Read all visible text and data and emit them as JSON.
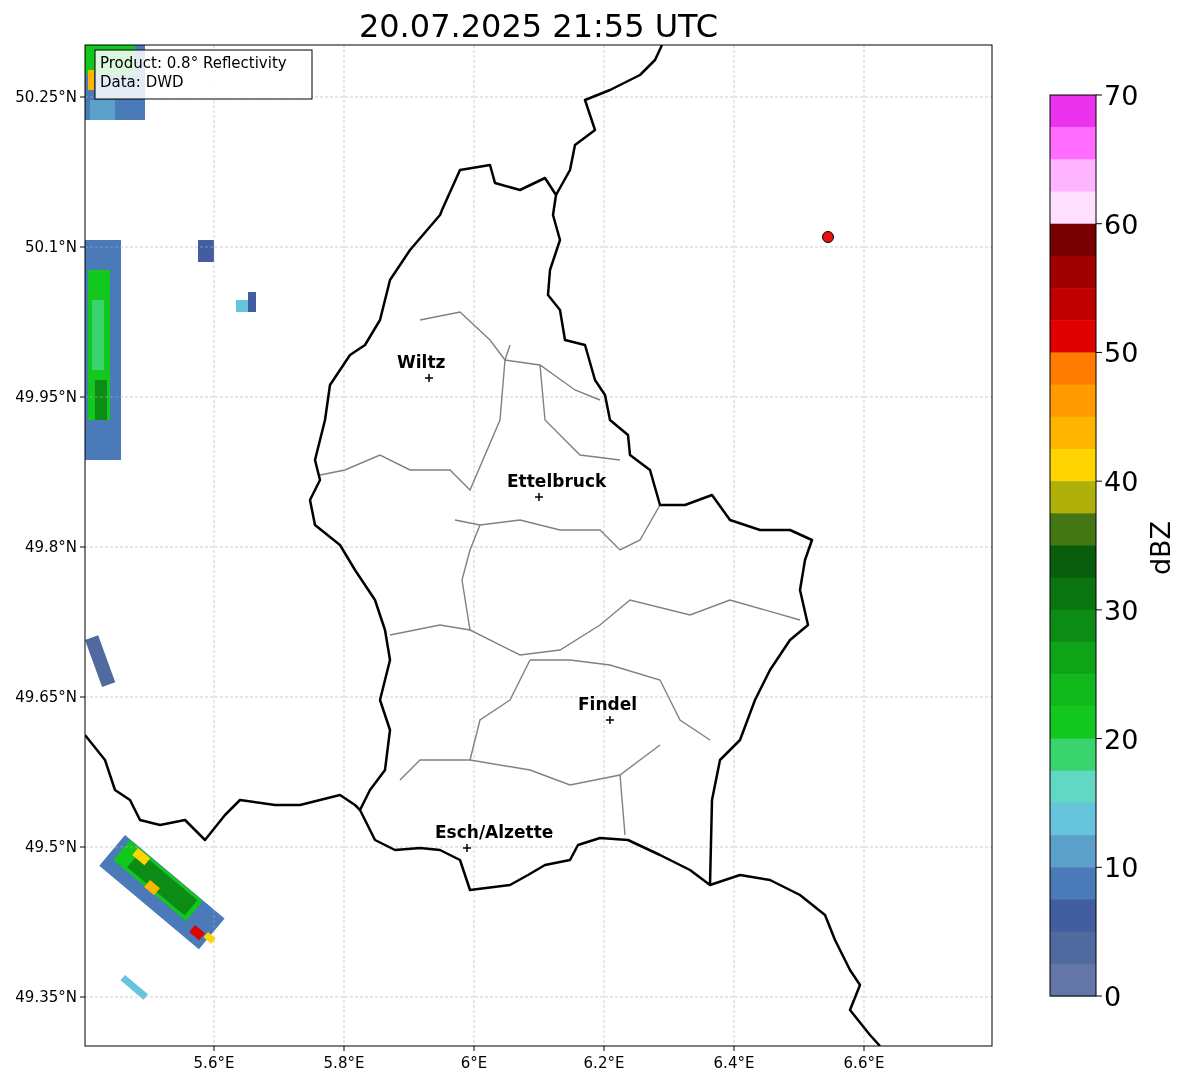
{
  "title": "20.07.2025 21:55 UTC",
  "map": {
    "x_tick_labels": [
      "5.6°E",
      "5.8°E",
      "6°E",
      "6.2°E",
      "6.4°E",
      "6.6°E"
    ],
    "y_tick_labels": [
      "50.25°N",
      "50.1°N",
      "49.95°N",
      "49.8°N",
      "49.65°N",
      "49.5°N",
      "49.35°N"
    ],
    "cities": [
      {
        "name": "Wiltz"
      },
      {
        "name": "Ettelbruck"
      },
      {
        "name": "Findel"
      },
      {
        "name": "Esch/Alzette"
      }
    ],
    "info_box": [
      "Product: 0.8° Reflectivity",
      "Data: DWD"
    ]
  },
  "colorbar": {
    "label": "dBZ",
    "ticks": [
      "70",
      "60",
      "50",
      "40",
      "30",
      "20",
      "10",
      "0"
    ],
    "bins": [
      {
        "color": "#ec32ec"
      },
      {
        "color": "#ff6cff"
      },
      {
        "color": "#ffb4ff"
      },
      {
        "color": "#ffe0ff"
      },
      {
        "color": "#780000"
      },
      {
        "color": "#a00000"
      },
      {
        "color": "#c00000"
      },
      {
        "color": "#e00000"
      },
      {
        "color": "#ff7c00"
      },
      {
        "color": "#ff9a00"
      },
      {
        "color": "#ffb400"
      },
      {
        "color": "#ffd400"
      },
      {
        "color": "#b0b00a"
      },
      {
        "color": "#447614"
      },
      {
        "color": "#085e0c"
      },
      {
        "color": "#0a7410"
      },
      {
        "color": "#0c8c14"
      },
      {
        "color": "#0ea418"
      },
      {
        "color": "#10b81c"
      },
      {
        "color": "#12c81e"
      },
      {
        "color": "#3ad46e"
      },
      {
        "color": "#62d8c4"
      },
      {
        "color": "#66c4dc"
      },
      {
        "color": "#5aa0c8"
      },
      {
        "color": "#4a7ab8"
      },
      {
        "color": "#435ea0"
      },
      {
        "color": "#506aa0"
      },
      {
        "color": "#6475a8"
      }
    ]
  }
}
